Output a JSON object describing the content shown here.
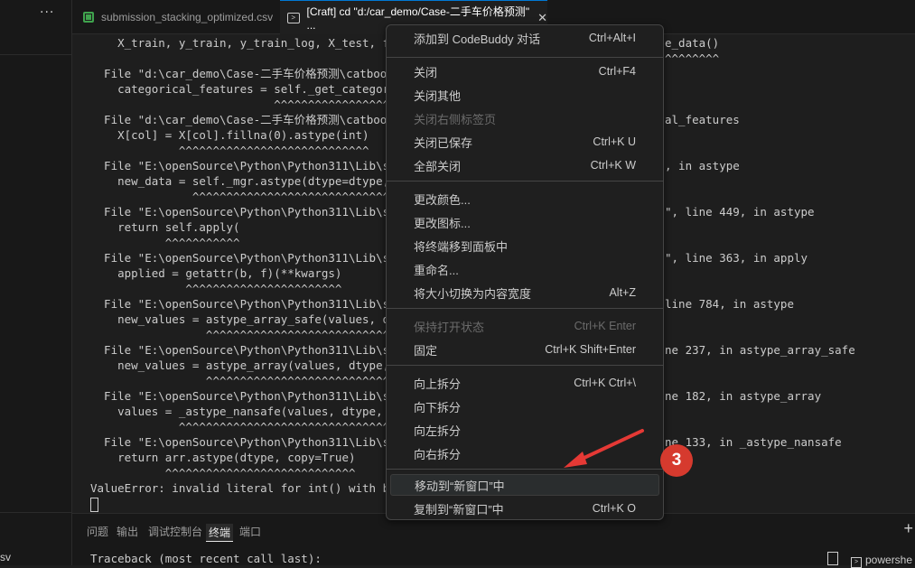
{
  "sidebar": {
    "more_label": "···",
    "file_label": "sv"
  },
  "tabs": [
    {
      "label": "submission_stacking_optimized.csv"
    },
    {
      "label": "[Craft] cd \"d:/car_demo/Case-二手车价格预测\" ...",
      "close": "✕"
    }
  ],
  "terminal": {
    "lines": [
      "    X_train, y_train, y_train_log, X_test, feat",
      "",
      "  File \"d:\\car_demo\\Case-二手车价格预测\\catboos",
      "    categorical_features = self._get_categorica",
      "                           ^^^^^^^^^^^^^^^^^^^^",
      "  File \"d:\\car_demo\\Case-二手车价格预测\\catboos",
      "    X[col] = X[col].fillna(0).astype(int)",
      "             ^^^^^^^^^^^^^^^^^^^^^^^^^^^^",
      "  File \"E:\\openSource\\Python\\Python311\\Lib\\site",
      "    new_data = self._mgr.astype(dtype=dtype, co",
      "               ^^^^^^^^^^^^^^^^^^^^^^^^^^^^^^^^",
      "  File \"E:\\openSource\\Python\\Python311\\Lib\\site",
      "    return self.apply(",
      "           ^^^^^^^^^^^",
      "  File \"E:\\openSource\\Python\\Python311\\Lib\\site",
      "    applied = getattr(b, f)(**kwargs)",
      "              ^^^^^^^^^^^^^^^^^^^^^^^",
      "  File \"E:\\openSource\\Python\\Python311\\Lib\\site",
      "    new_values = astype_array_safe(values, dtyp",
      "                 ^^^^^^^^^^^^^^^^^^^^^^^^^^^^^^^",
      "  File \"E:\\openSource\\Python\\Python311\\Lib\\site",
      "    new_values = astype_array(values, dtype, co",
      "                 ^^^^^^^^^^^^^^^^^^^^^^^^^^^^^^^",
      "  File \"E:\\openSource\\Python\\Python311\\Lib\\site",
      "    values = _astype_nansafe(values, dtype, cop",
      "             ^^^^^^^^^^^^^^^^^^^^^^^^^^^^^^^^^^",
      "  File \"E:\\openSource\\Python\\Python311\\Lib\\site",
      "    return arr.astype(dtype, copy=True)",
      "           ^^^^^^^^^^^^^^^^^^^^^^^^^^^^",
      "",
      "ValueError: invalid literal for int() with base"
    ],
    "right_fragments": [
      "e_data()",
      "^^^^^^^^",
      "al_features",
      ", in astype",
      "\", line 449, in astype",
      "\", line 363, in apply",
      "line 784, in astype",
      "ne 237, in astype_array_safe",
      "ne 182, in astype_array",
      "ne 133, in _astype_nansafe"
    ]
  },
  "panel": {
    "tabs": [
      "问题",
      "输出",
      "调试控制台",
      "终端",
      "端口"
    ],
    "plus": "+",
    "traceback": "Traceback (most recent call last):",
    "shell": "powershe"
  },
  "menu": {
    "items": [
      {
        "label": "添加到 CodeBuddy 对话",
        "shortcut": "Ctrl+Alt+I"
      },
      {
        "label": "关闭",
        "shortcut": "Ctrl+F4"
      },
      {
        "label": "关闭其他",
        "shortcut": ""
      },
      {
        "label": "关闭右侧标签页",
        "shortcut": ""
      },
      {
        "label": "关闭已保存",
        "shortcut": "Ctrl+K U"
      },
      {
        "label": "全部关闭",
        "shortcut": "Ctrl+K W"
      },
      {
        "label": "更改颜色...",
        "shortcut": ""
      },
      {
        "label": "更改图标...",
        "shortcut": ""
      },
      {
        "label": "将终端移到面板中",
        "shortcut": ""
      },
      {
        "label": "重命名...",
        "shortcut": ""
      },
      {
        "label": "将大小切换为内容宽度",
        "shortcut": "Alt+Z"
      },
      {
        "label": "保持打开状态",
        "shortcut": "Ctrl+K Enter"
      },
      {
        "label": "固定",
        "shortcut": "Ctrl+K Shift+Enter"
      },
      {
        "label": "向上拆分",
        "shortcut": "Ctrl+K Ctrl+\\"
      },
      {
        "label": "向下拆分",
        "shortcut": ""
      },
      {
        "label": "向左拆分",
        "shortcut": ""
      },
      {
        "label": "向右拆分",
        "shortcut": ""
      },
      {
        "label": "移动到“新窗口”中",
        "shortcut": ""
      },
      {
        "label": "复制到“新窗口”中",
        "shortcut": "Ctrl+K O"
      }
    ]
  },
  "annotation": {
    "badge": "3",
    "arrow_color": "#e53935",
    "badge_color": "#d63a2e"
  }
}
